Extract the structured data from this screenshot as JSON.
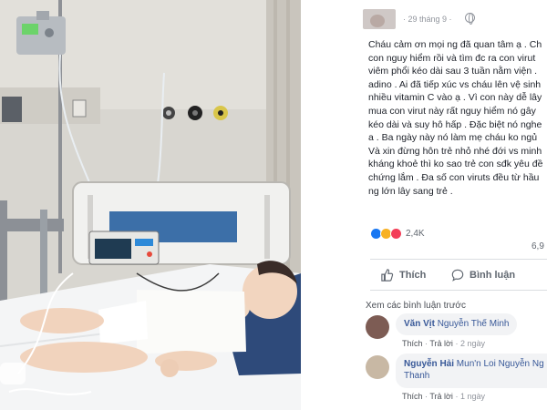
{
  "post": {
    "timestamp": "· 29 tháng 9 ·",
    "text_lines": [
      "Cháu cảm ơn mọi ng đã quan tâm ạ . Ch",
      "con nguy hiểm rồi và tìm đc ra con virut",
      "viêm phổi kéo dài sau 3 tuần nằm viện .",
      "adino . Ai đã tiếp xúc vs cháu lên vệ sinh",
      "nhiều vitamin C vào ạ . Vì con này dễ lây",
      "mua con virut này rất nguy hiểm nó gây",
      "kéo dài và suy hô hấp . Đặc biệt nó nghe",
      "a . Ba ngày này nó làm mẹ cháu ko ngủ",
      "Và xin đừng hôn trẻ nhỏ nhé đới vs minh",
      "kháng khoẻ thì ko sao trẻ con sđk yêu đề",
      "chứng lắm . Đa số con viruts đều từ hầu",
      "ng lớn lây sang trẻ ."
    ],
    "reaction_count": "2,4K",
    "share_count": "6,9"
  },
  "actions": {
    "like_label": "Thích",
    "comment_label": "Bình luận"
  },
  "comments_section": {
    "view_previous": "Xem các bình luận trước",
    "comments": [
      {
        "author": "Văn Vịt",
        "tag": "Nguyễn Thế Minh",
        "tag_line2": "",
        "like_label": "Thích",
        "reply_label": "Trả lời",
        "time": "· 2 ngày"
      },
      {
        "author": "Nguyễn Hải",
        "tag": "Mun'n Loi Nguyễn Ng",
        "tag_line2": "Thanh",
        "like_label": "Thích",
        "reply_label": "Trả lời",
        "time": "· 1 ngày"
      }
    ]
  },
  "colors": {
    "link_blue": "#385898",
    "like_blue": "#1877f2",
    "sad_yellow": "#f7b125",
    "love_red": "#f33e58",
    "meta_gray": "#90949c"
  },
  "icons": [
    "globe-icon",
    "like-reaction-icon",
    "sad-reaction-icon",
    "love-reaction-icon",
    "thumbs-up-icon",
    "comment-bubble-icon"
  ]
}
